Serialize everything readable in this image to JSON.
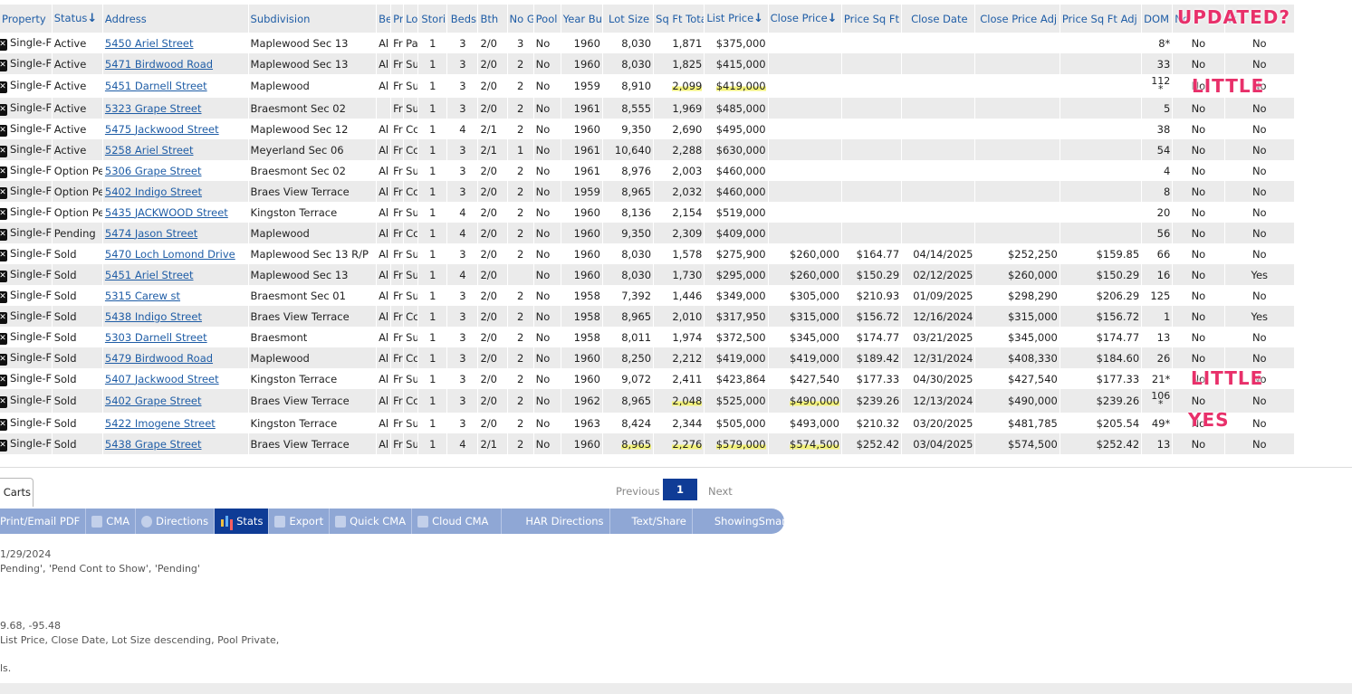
{
  "columns": [
    "Property",
    "Status",
    "Address",
    "Subdivision",
    "Be",
    "Pr",
    "Lo",
    "Stori",
    "Beds",
    "Bth",
    "No G",
    "Pool",
    "Year Bu",
    "Lot Size",
    "Sq Ft Total",
    "List Price",
    "Close Price",
    "Price Sq Ft",
    "Close Date",
    "Close Price Adj",
    "Price Sq Ft Adj",
    "DOM",
    "No",
    "Tr"
  ],
  "sort_arrow": "↓",
  "rows": [
    {
      "type": "Single-F",
      "status": "Active",
      "address": "5450 Ariel Street",
      "subdivision": "Maplewood Sec 13",
      "be": "Al",
      "pr": "Fr",
      "lo": "Pa",
      "stories": "1",
      "beds": "3",
      "bth": "2/0",
      "nog": "3",
      "pool": "No",
      "year": "1960",
      "lot": "8,030",
      "sqft": "1,871",
      "list": "$375,000",
      "close": "",
      "psf": "",
      "cdate": "",
      "cpadj": "",
      "psfadj": "",
      "dom": "8*",
      "no": "No",
      "tr": "No"
    },
    {
      "type": "Single-F",
      "status": "Active",
      "address": "5471 Birdwood Road",
      "subdivision": "Maplewood Sec 13",
      "be": "Al",
      "pr": "Fr",
      "lo": "Su",
      "stories": "1",
      "beds": "3",
      "bth": "2/0",
      "nog": "2",
      "pool": "No",
      "year": "1960",
      "lot": "8,030",
      "sqft": "1,825",
      "list": "$415,000",
      "close": "",
      "psf": "",
      "cdate": "",
      "cpadj": "",
      "psfadj": "",
      "dom": "33",
      "no": "No",
      "tr": "No"
    },
    {
      "type": "Single-F",
      "status": "Active",
      "address": "5451 Darnell Street",
      "subdivision": "Maplewood",
      "be": "Al",
      "pr": "Fr",
      "lo": "Su",
      "stories": "1",
      "beds": "3",
      "bth": "2/0",
      "nog": "2",
      "pool": "No",
      "year": "1959",
      "lot": "8,910",
      "sqft": "2,099",
      "list": "$419,000",
      "close": "",
      "psf": "",
      "cdate": "",
      "cpadj": "",
      "psfadj": "",
      "dom": "112",
      "dom2": "*",
      "no": "No",
      "tr": "No"
    },
    {
      "type": "Single-F",
      "status": "Active",
      "address": "5323 Grape Street",
      "subdivision": "Braesmont Sec 02",
      "be": "",
      "pr": "Fr",
      "lo": "Su",
      "stories": "1",
      "beds": "3",
      "bth": "2/0",
      "nog": "2",
      "pool": "No",
      "year": "1961",
      "lot": "8,555",
      "sqft": "1,969",
      "list": "$485,000",
      "close": "",
      "psf": "",
      "cdate": "",
      "cpadj": "",
      "psfadj": "",
      "dom": "5",
      "no": "No",
      "tr": "No"
    },
    {
      "type": "Single-F",
      "status": "Active",
      "address": "5475 Jackwood Street",
      "subdivision": "Maplewood Sec 12",
      "be": "Al",
      "pr": "Fr",
      "lo": "Cc",
      "stories": "1",
      "beds": "4",
      "bth": "2/1",
      "nog": "2",
      "pool": "No",
      "year": "1960",
      "lot": "9,350",
      "sqft": "2,690",
      "list": "$495,000",
      "close": "",
      "psf": "",
      "cdate": "",
      "cpadj": "",
      "psfadj": "",
      "dom": "38",
      "no": "No",
      "tr": "No"
    },
    {
      "type": "Single-F",
      "status": "Active",
      "address": "5258 Ariel Street",
      "subdivision": "Meyerland Sec 06",
      "be": "Al",
      "pr": "Fr",
      "lo": "Cc",
      "stories": "1",
      "beds": "3",
      "bth": "2/1",
      "nog": "1",
      "pool": "No",
      "year": "1961",
      "lot": "10,640",
      "sqft": "2,288",
      "list": "$630,000",
      "close": "",
      "psf": "",
      "cdate": "",
      "cpadj": "",
      "psfadj": "",
      "dom": "54",
      "no": "No",
      "tr": "No"
    },
    {
      "type": "Single-F",
      "status": "Option Pe",
      "address": "5306 Grape Street",
      "subdivision": "Braesmont Sec 02",
      "be": "Al",
      "pr": "Fr",
      "lo": "Su",
      "stories": "1",
      "beds": "3",
      "bth": "2/0",
      "nog": "2",
      "pool": "No",
      "year": "1961",
      "lot": "8,976",
      "sqft": "2,003",
      "list": "$460,000",
      "close": "",
      "psf": "",
      "cdate": "",
      "cpadj": "",
      "psfadj": "",
      "dom": "4",
      "no": "No",
      "tr": "No"
    },
    {
      "type": "Single-F",
      "status": "Option Pe",
      "address": "5402 Indigo Street",
      "subdivision": "Braes View Terrace",
      "be": "Al",
      "pr": "Fr",
      "lo": "Cc",
      "stories": "1",
      "beds": "3",
      "bth": "2/0",
      "nog": "2",
      "pool": "No",
      "year": "1959",
      "lot": "8,965",
      "sqft": "2,032",
      "list": "$460,000",
      "close": "",
      "psf": "",
      "cdate": "",
      "cpadj": "",
      "psfadj": "",
      "dom": "8",
      "no": "No",
      "tr": "No"
    },
    {
      "type": "Single-F",
      "status": "Option Pe",
      "address": "5435 JACKWOOD Street",
      "subdivision": "Kingston Terrace",
      "be": "Al",
      "pr": "Fr",
      "lo": "Su",
      "stories": "1",
      "beds": "4",
      "bth": "2/0",
      "nog": "2",
      "pool": "No",
      "year": "1960",
      "lot": "8,136",
      "sqft": "2,154",
      "list": "$519,000",
      "close": "",
      "psf": "",
      "cdate": "",
      "cpadj": "",
      "psfadj": "",
      "dom": "20",
      "no": "No",
      "tr": "No"
    },
    {
      "type": "Single-F",
      "status": "Pending",
      "address": "5474 Jason Street",
      "subdivision": "Maplewood",
      "be": "Al",
      "pr": "Fr",
      "lo": "Cc",
      "stories": "1",
      "beds": "4",
      "bth": "2/0",
      "nog": "2",
      "pool": "No",
      "year": "1960",
      "lot": "9,350",
      "sqft": "2,309",
      "list": "$409,000",
      "close": "",
      "psf": "",
      "cdate": "",
      "cpadj": "",
      "psfadj": "",
      "dom": "56",
      "no": "No",
      "tr": "No"
    },
    {
      "type": "Single-F",
      "status": "Sold",
      "address": "5470 Loch Lomond Drive",
      "subdivision": "Maplewood Sec 13 R/P",
      "be": "Al",
      "pr": "Fr",
      "lo": "Su",
      "stories": "1",
      "beds": "3",
      "bth": "2/0",
      "nog": "2",
      "pool": "No",
      "year": "1960",
      "lot": "8,030",
      "sqft": "1,578",
      "list": "$275,900",
      "close": "$260,000",
      "psf": "$164.77",
      "cdate": "04/14/2025",
      "cpadj": "$252,250",
      "psfadj": "$159.85",
      "dom": "66",
      "no": "No",
      "tr": "No"
    },
    {
      "type": "Single-F",
      "status": "Sold",
      "address": "5451 Ariel Street",
      "subdivision": "Maplewood Sec 13",
      "be": "Al",
      "pr": "Fr",
      "lo": "Su",
      "stories": "1",
      "beds": "4",
      "bth": "2/0",
      "nog": "",
      "pool": "No",
      "year": "1960",
      "lot": "8,030",
      "sqft": "1,730",
      "list": "$295,000",
      "close": "$260,000",
      "psf": "$150.29",
      "cdate": "02/12/2025",
      "cpadj": "$260,000",
      "psfadj": "$150.29",
      "dom": "16",
      "no": "No",
      "tr": "Yes"
    },
    {
      "type": "Single-F",
      "status": "Sold",
      "address": "5315 Carew st",
      "subdivision": "Braesmont Sec 01",
      "be": "Al",
      "pr": "Fr",
      "lo": "Su",
      "stories": "1",
      "beds": "3",
      "bth": "2/0",
      "nog": "2",
      "pool": "No",
      "year": "1958",
      "lot": "7,392",
      "sqft": "1,446",
      "list": "$349,000",
      "close": "$305,000",
      "psf": "$210.93",
      "cdate": "01/09/2025",
      "cpadj": "$298,290",
      "psfadj": "$206.29",
      "dom": "125",
      "no": "No",
      "tr": "No"
    },
    {
      "type": "Single-F",
      "status": "Sold",
      "address": "5438 Indigo Street",
      "subdivision": "Braes View Terrace",
      "be": "Al",
      "pr": "Fr",
      "lo": "Cc",
      "stories": "1",
      "beds": "3",
      "bth": "2/0",
      "nog": "2",
      "pool": "No",
      "year": "1958",
      "lot": "8,965",
      "sqft": "2,010",
      "list": "$317,950",
      "close": "$315,000",
      "psf": "$156.72",
      "cdate": "12/16/2024",
      "cpadj": "$315,000",
      "psfadj": "$156.72",
      "dom": "1",
      "no": "No",
      "tr": "Yes"
    },
    {
      "type": "Single-F",
      "status": "Sold",
      "address": "5303 Darnell Street",
      "subdivision": "Braesmont",
      "be": "Al",
      "pr": "Fr",
      "lo": "Su",
      "stories": "1",
      "beds": "3",
      "bth": "2/0",
      "nog": "2",
      "pool": "No",
      "year": "1958",
      "lot": "8,011",
      "sqft": "1,974",
      "list": "$372,500",
      "close": "$345,000",
      "psf": "$174.77",
      "cdate": "03/21/2025",
      "cpadj": "$345,000",
      "psfadj": "$174.77",
      "dom": "13",
      "no": "No",
      "tr": "No"
    },
    {
      "type": "Single-F",
      "status": "Sold",
      "address": "5479 Birdwood Road",
      "subdivision": "Maplewood",
      "be": "Al",
      "pr": "Fr",
      "lo": "Cc",
      "stories": "1",
      "beds": "3",
      "bth": "2/0",
      "nog": "2",
      "pool": "No",
      "year": "1960",
      "lot": "8,250",
      "sqft": "2,212",
      "list": "$419,000",
      "close": "$419,000",
      "psf": "$189.42",
      "cdate": "12/31/2024",
      "cpadj": "$408,330",
      "psfadj": "$184.60",
      "dom": "26",
      "no": "No",
      "tr": "No"
    },
    {
      "type": "Single-F",
      "status": "Sold",
      "address": "5407 Jackwood Street",
      "subdivision": "Kingston Terrace",
      "be": "Al",
      "pr": "Fr",
      "lo": "Su",
      "stories": "1",
      "beds": "3",
      "bth": "2/0",
      "nog": "2",
      "pool": "No",
      "year": "1960",
      "lot": "9,072",
      "sqft": "2,411",
      "list": "$423,864",
      "close": "$427,540",
      "psf": "$177.33",
      "cdate": "04/30/2025",
      "cpadj": "$427,540",
      "psfadj": "$177.33",
      "dom": "21*",
      "no": "No",
      "tr": "No"
    },
    {
      "type": "Single-F",
      "status": "Sold",
      "address": "5402 Grape Street",
      "subdivision": "Braes View Terrace",
      "be": "Al",
      "pr": "Fr",
      "lo": "Cc",
      "stories": "1",
      "beds": "3",
      "bth": "2/0",
      "nog": "2",
      "pool": "No",
      "year": "1962",
      "lot": "8,965",
      "sqft": "2,048",
      "list": "$525,000",
      "close": "$490,000",
      "psf": "$239.26",
      "cdate": "12/13/2024",
      "cpadj": "$490,000",
      "psfadj": "$239.26",
      "dom": "106",
      "dom2": "*",
      "no": "No",
      "tr": "No"
    },
    {
      "type": "Single-F",
      "status": "Sold",
      "address": "5422 Imogene Street",
      "subdivision": "Kingston Terrace",
      "be": "Al",
      "pr": "Fr",
      "lo": "Su",
      "stories": "1",
      "beds": "3",
      "bth": "2/0",
      "nog": "2",
      "pool": "No",
      "year": "1963",
      "lot": "8,424",
      "sqft": "2,344",
      "list": "$505,000",
      "close": "$493,000",
      "psf": "$210.32",
      "cdate": "03/20/2025",
      "cpadj": "$481,785",
      "psfadj": "$205.54",
      "dom": "49*",
      "no": "No",
      "tr": "No"
    },
    {
      "type": "Single-F",
      "status": "Sold",
      "address": "5438 Grape Street",
      "subdivision": "Braes View Terrace",
      "be": "Al",
      "pr": "Fr",
      "lo": "Su",
      "stories": "1",
      "beds": "4",
      "bth": "2/1",
      "nog": "2",
      "pool": "No",
      "year": "1960",
      "lot": "8,965",
      "sqft": "2,276",
      "list": "$579,000",
      "close": "$574,500",
      "psf": "$252.42",
      "cdate": "03/04/2025",
      "cpadj": "$574,500",
      "psfadj": "$252.42",
      "dom": "13",
      "no": "No",
      "tr": "No"
    }
  ],
  "highlights": [
    {
      "row": 2,
      "cols": [
        "sqft",
        "list"
      ]
    },
    {
      "row": 17,
      "cols": [
        "sqft",
        "close"
      ]
    },
    {
      "row": 19,
      "cols": [
        "lot",
        "sqft",
        "list",
        "close"
      ]
    }
  ],
  "annotations": [
    "UPDATED?",
    "LITTLE",
    "LITTLE",
    "YES"
  ],
  "tabs": {
    "carts": "Carts"
  },
  "pager": {
    "previous": "Previous",
    "current": "1",
    "next": "Next"
  },
  "toolbar": [
    {
      "label": "Print/Email PDF",
      "icon": "none"
    },
    {
      "label": "CMA",
      "icon": "doc-icon"
    },
    {
      "label": "Directions",
      "icon": "compass-icon"
    },
    {
      "label": "Stats",
      "icon": "bar-chart-icon",
      "active": true
    },
    {
      "label": "Export",
      "icon": "export-icon"
    },
    {
      "label": "Quick CMA",
      "icon": "doc-icon"
    },
    {
      "label": "Cloud CMA",
      "icon": "doc-icon"
    },
    {
      "label": "HAR Directions",
      "icon": "none"
    },
    {
      "label": "Text/Share",
      "icon": "none"
    },
    {
      "label": "ShowingSmart",
      "icon": "none"
    }
  ],
  "criteria": [
    "1/29/2024",
    "Pending', 'Pend Cont to Show', 'Pending'",
    "9.68, -95.48",
    "List Price, Close Date, Lot Size descending, Pool Private,",
    "ls."
  ]
}
